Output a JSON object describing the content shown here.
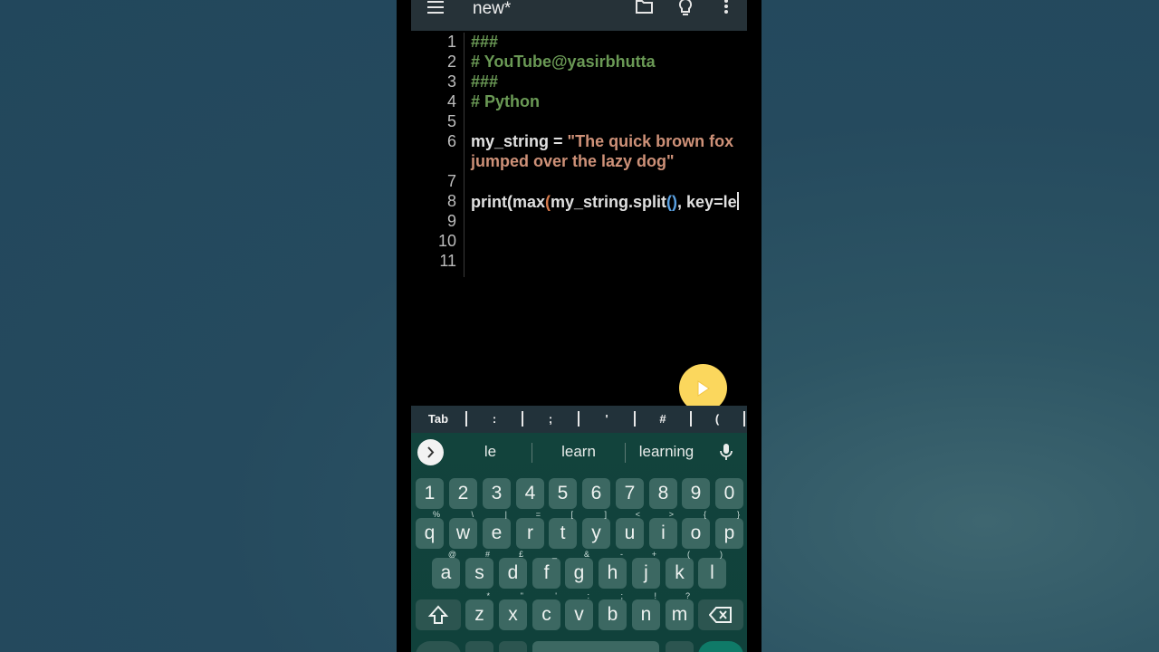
{
  "toolbar": {
    "title": "new*",
    "icons": [
      "menu-icon",
      "folder-icon",
      "lightbulb-icon",
      "more-vert-icon"
    ]
  },
  "editor": {
    "line_numbers": [
      "1",
      "2",
      "3",
      "4",
      "5",
      "6",
      "7",
      "8",
      "9",
      "10",
      "11"
    ],
    "lines": {
      "l1": "###",
      "l2": "# YouTube@yasirbhutta",
      "l3": "###",
      "l4": "# Python",
      "l6_var": "my_string = ",
      "l6_str": "\"The quick brown fox",
      "l6_str2": "jumped over the lazy dog\"",
      "l8_a": "print(max",
      "l8_p1": "(",
      "l8_b": "my_string.split",
      "l8_p2": "()",
      "l8_c": ", key=le"
    }
  },
  "fab": {
    "icon": "play-icon",
    "color": "#fbd75d"
  },
  "extra_keys": [
    "Tab",
    ":",
    ";",
    "'",
    "#",
    "("
  ],
  "suggestions": [
    "le",
    "learn",
    "learning"
  ],
  "keyboard": {
    "numbers": [
      "1",
      "2",
      "3",
      "4",
      "5",
      "6",
      "7",
      "8",
      "9",
      "0"
    ],
    "row1": [
      "q",
      "w",
      "e",
      "r",
      "t",
      "y",
      "u",
      "i",
      "o",
      "p"
    ],
    "row1_hints": [
      "%",
      "\\",
      "|",
      "=",
      "[",
      "]",
      "<",
      ">",
      "{",
      "}"
    ],
    "row2": [
      "a",
      "s",
      "d",
      "f",
      "g",
      "h",
      "j",
      "k",
      "l"
    ],
    "row2_hints": [
      "@",
      "#",
      "£",
      "_",
      "&",
      "-",
      "+",
      "(",
      ")"
    ],
    "row3": [
      "z",
      "x",
      "c",
      "v",
      "b",
      "n",
      "m"
    ],
    "row3_hints": [
      "*",
      "\"",
      "'",
      ":",
      ";",
      "!",
      "?"
    ]
  }
}
